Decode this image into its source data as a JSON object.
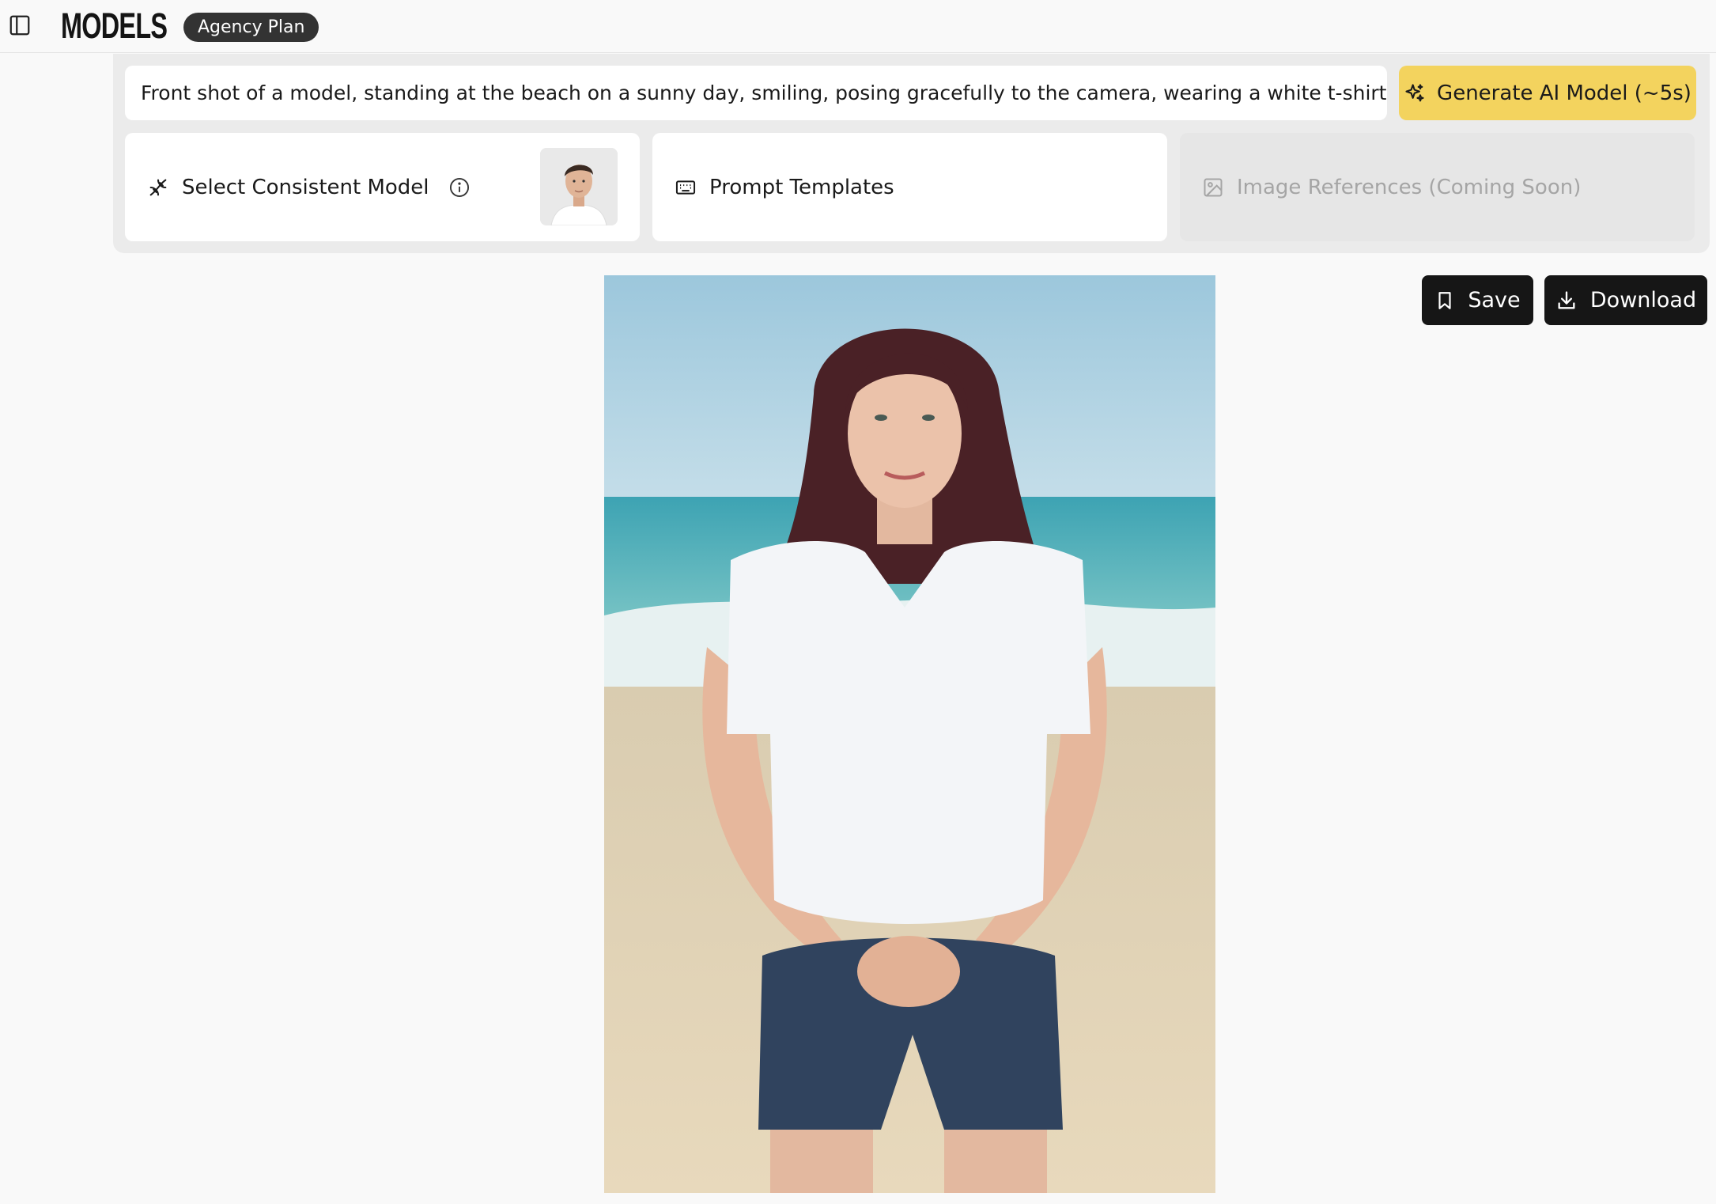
{
  "header": {
    "logo": "MODELS",
    "plan_badge": "Agency Plan"
  },
  "prompt": {
    "value": "Front shot of a model, standing at the beach on a sunny day, smiling, posing gracefully to the camera, wearing a white t-shirt and dark blue denim shorts"
  },
  "generate": {
    "label": "Generate AI Model (~5s)"
  },
  "options": {
    "select_model_label": "Select Consistent Model",
    "prompt_templates_label": "Prompt Templates",
    "image_references_label": "Image References (Coming Soon)"
  },
  "actions": {
    "save_label": "Save",
    "download_label": "Download"
  },
  "colors": {
    "accent": "#f3d35e",
    "dark_button": "#161616",
    "badge": "#333333"
  }
}
